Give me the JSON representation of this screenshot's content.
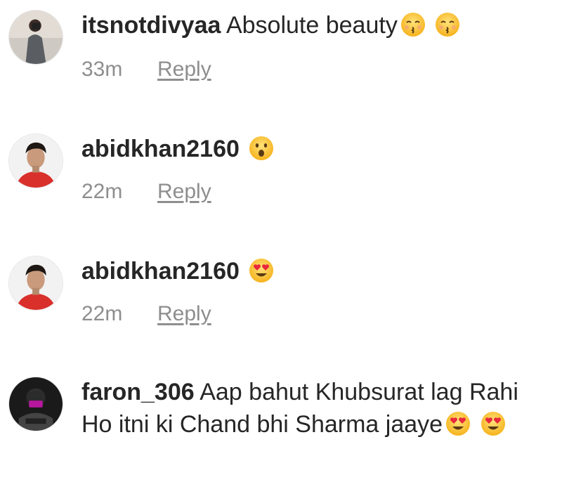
{
  "comments": [
    {
      "username": "itsnotdivyaa",
      "text": "Absolute beauty",
      "emojis": [
        "kissing-face-icon",
        "kissing-face-icon"
      ],
      "time": "33m",
      "reply_label": "Reply"
    },
    {
      "username": "abidkhan2160",
      "text": "",
      "emojis": [
        "surprised-face-icon"
      ],
      "time": "22m",
      "reply_label": "Reply"
    },
    {
      "username": "abidkhan2160",
      "text": "",
      "emojis": [
        "heart-eyes-icon"
      ],
      "time": "22m",
      "reply_label": "Reply"
    },
    {
      "username": "faron_306",
      "text": "Aap bahut Khubsurat lag Rahi Ho itni ki Chand bhi Sharma jaaye",
      "emojis": [
        "heart-eyes-icon",
        "heart-eyes-icon"
      ]
    }
  ],
  "colors": {
    "text": "#262626",
    "meta": "#8e8e8e",
    "emoji": "#fbc93d"
  }
}
